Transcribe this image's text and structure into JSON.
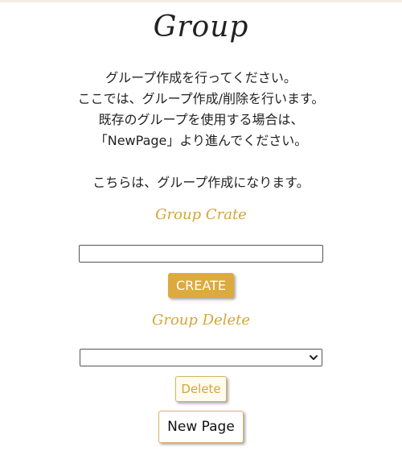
{
  "page": {
    "title": "Group"
  },
  "description": {
    "lines": [
      "グループ作成を行ってください。",
      "ここでは、グループ作成/削除を行います。",
      "既存のグループを使用する場合は、",
      "「NewPage」より進んでください。"
    ],
    "note": "こちらは、グループ作成になります。"
  },
  "create_section": {
    "heading": "Group Crate",
    "input_value": "",
    "button_label": "CREATE"
  },
  "delete_section": {
    "heading": "Group Delete",
    "selected_value": "",
    "button_label": "Delete"
  },
  "navigation": {
    "new_page_label": "New Page"
  },
  "colors": {
    "accent": "#dcaa3f",
    "heading": "#d4a63b",
    "text": "#222222",
    "background": "#ffffff"
  },
  "icons": {
    "select_arrow": "chevron-down-icon"
  }
}
